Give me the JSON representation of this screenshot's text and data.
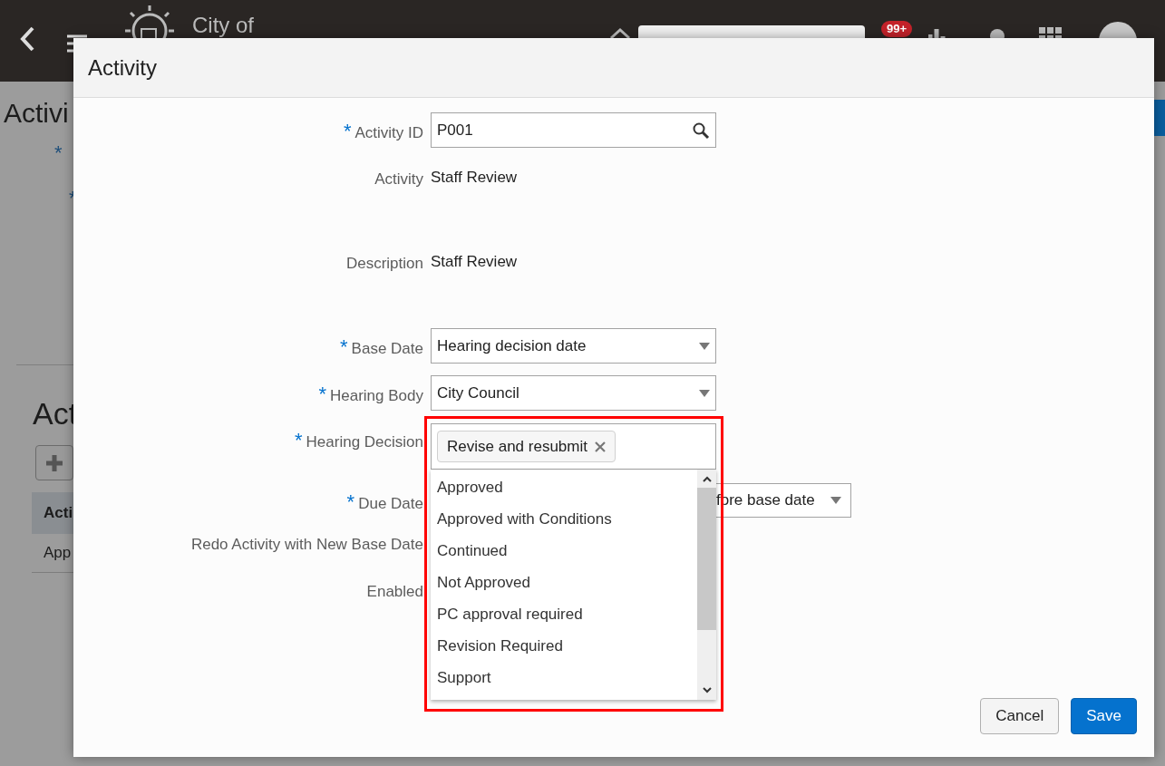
{
  "app_bar": {
    "logo_text": "City of",
    "notification_count": "99+"
  },
  "page": {
    "title": "Activi",
    "required_marks": [
      "*",
      "*"
    ],
    "section_title": "Act",
    "table": {
      "columns": [
        "Acti"
      ],
      "rows": [
        [
          "App"
        ]
      ]
    }
  },
  "dialog": {
    "title": "Activity",
    "fields": [
      {
        "kind": "lookup",
        "label": "Activity ID",
        "required": true,
        "value": "P001"
      },
      {
        "kind": "text",
        "label": "Activity",
        "required": false,
        "value": "Staff Review"
      },
      {
        "kind": "text",
        "label": "Description",
        "required": false,
        "value": "Staff Review"
      },
      {
        "kind": "select",
        "label": "Base Date",
        "required": true,
        "value": "Hearing decision date"
      },
      {
        "kind": "select",
        "label": "Hearing Body",
        "required": true,
        "value": "City Council"
      },
      {
        "kind": "multiselect",
        "label": "Hearing Decision",
        "required": true,
        "highlighted": true,
        "tokens": [
          "Revise and resubmit"
        ],
        "options": [
          "Approved",
          "Approved with Conditions",
          "Continued",
          "Not Approved",
          "PC approval required",
          "Revision Required",
          "Support"
        ]
      },
      {
        "kind": "covered-select",
        "label": "Due Date",
        "required": true,
        "value": "fore base date"
      },
      {
        "kind": "label",
        "label": "Redo Activity with New Base Date",
        "required": false
      },
      {
        "kind": "label",
        "label": "Enabled",
        "required": false
      }
    ],
    "buttons": [
      {
        "label": "Cancel",
        "primary": false
      },
      {
        "label": "Save",
        "primary": true
      }
    ]
  }
}
